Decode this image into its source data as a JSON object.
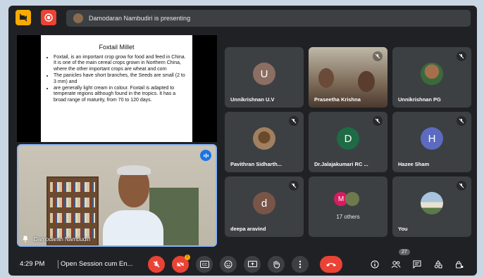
{
  "topbar": {
    "presenting_text": "Damodaran Nambudiri is presenting"
  },
  "slide": {
    "title": "Foxtail Millet",
    "bullets": [
      "Foxtail, is an important crop grow for food and feed in China. It is one of the main cereal crops grown in Northern China, where the other important crops are wheat and corn",
      "The panicles have short branches, the Seeds are small (2 to 3 mm) and",
      "are generally light cream in colour. Foxtail is adapted to temperate regions although found in the tropics. It has a broad range of maturity, from 70 to 120 days."
    ]
  },
  "presenter": {
    "name": "Damodaran Nambudiri"
  },
  "participants": [
    {
      "name": "Unnikrishnan U.V",
      "initial": "U",
      "color": "#8d6e63",
      "type": "initial"
    },
    {
      "name": "Praseetha Krishna",
      "initial": "",
      "color": "#6d5d4e",
      "type": "video"
    },
    {
      "name": "Unnikrishnan PG",
      "initial": "",
      "color": "#7a6a5a",
      "type": "photo"
    },
    {
      "name": "Pavithran Sidharth...",
      "initial": "",
      "color": "#7a6a5a",
      "type": "photo"
    },
    {
      "name": "Dr.Jalajakumari RC ...",
      "initial": "D",
      "color": "#1e6b45",
      "type": "initial"
    },
    {
      "name": "Hazee Sham",
      "initial": "H",
      "color": "#5c6bc0",
      "type": "initial"
    },
    {
      "name": "deepa aravind",
      "initial": "d",
      "color": "#795548",
      "type": "initial"
    },
    {
      "name": "17 others",
      "initial": "M",
      "color": "#d81b60",
      "type": "others"
    },
    {
      "name": "You",
      "initial": "",
      "color": "#7a8a9a",
      "type": "photo"
    }
  ],
  "bottombar": {
    "time": "4:29 PM",
    "separator": "|",
    "meeting_title": "Open Session cum En...",
    "people_count": "27",
    "notification_badge": "!"
  }
}
